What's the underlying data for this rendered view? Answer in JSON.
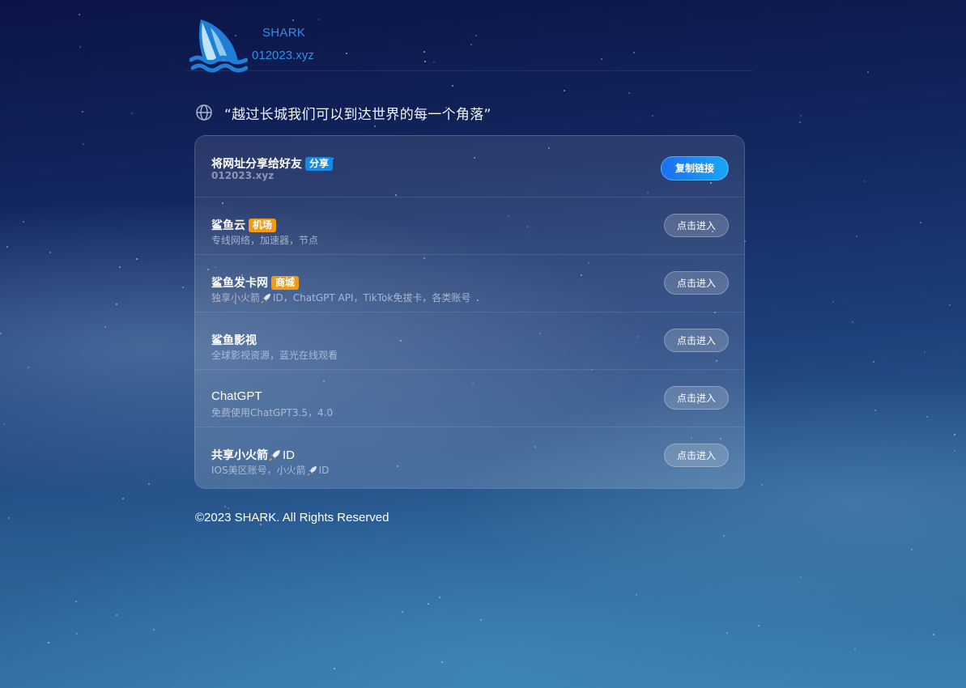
{
  "brand": {
    "name": "SHARK",
    "domain": "012023.xyz"
  },
  "motto": "“越过长城我们可以到达世界的每一个角落”",
  "rows": [
    {
      "title": "将网址分享给好友",
      "tag": "分享",
      "tag_color": "#1689e6",
      "subtitle": "012023.xyz",
      "button": "复制链接"
    },
    {
      "title": "鲨鱼云",
      "tag": "机场",
      "tag_color": "#f29b13",
      "subtitle": "专线网络，加速器，节点",
      "button": "点击进入"
    },
    {
      "title": "鲨鱼发卡网",
      "tag": "商城",
      "tag_color": "#f29b13",
      "subtitle_parts": [
        "独享小火箭",
        "ID，ChatGPT API，TikTok免拔卡，各类账号"
      ],
      "button": "点击进入"
    },
    {
      "title": "鲨鱼影视",
      "subtitle": "全球影视资源，蓝光在线观看",
      "button": "点击进入"
    },
    {
      "title": "ChatGPT",
      "subtitle": "免费使用ChatGPT3.5，4.0",
      "button": "点击进入"
    },
    {
      "title_parts": [
        "共享小火箭",
        "ID"
      ],
      "subtitle_parts": [
        "IOS美区账号，小火箭",
        "ID"
      ],
      "button": "点击进入"
    }
  ],
  "footer": "©2023 SHARK. All Rights Reserved",
  "icons": {
    "logo": "shark-fin-logo",
    "motto": "globe-icon",
    "inline": "rocket-icon"
  },
  "colors": {
    "accent": "#2f8fe8",
    "tag_blue": "#1689e6",
    "tag_orange": "#f29b13"
  }
}
